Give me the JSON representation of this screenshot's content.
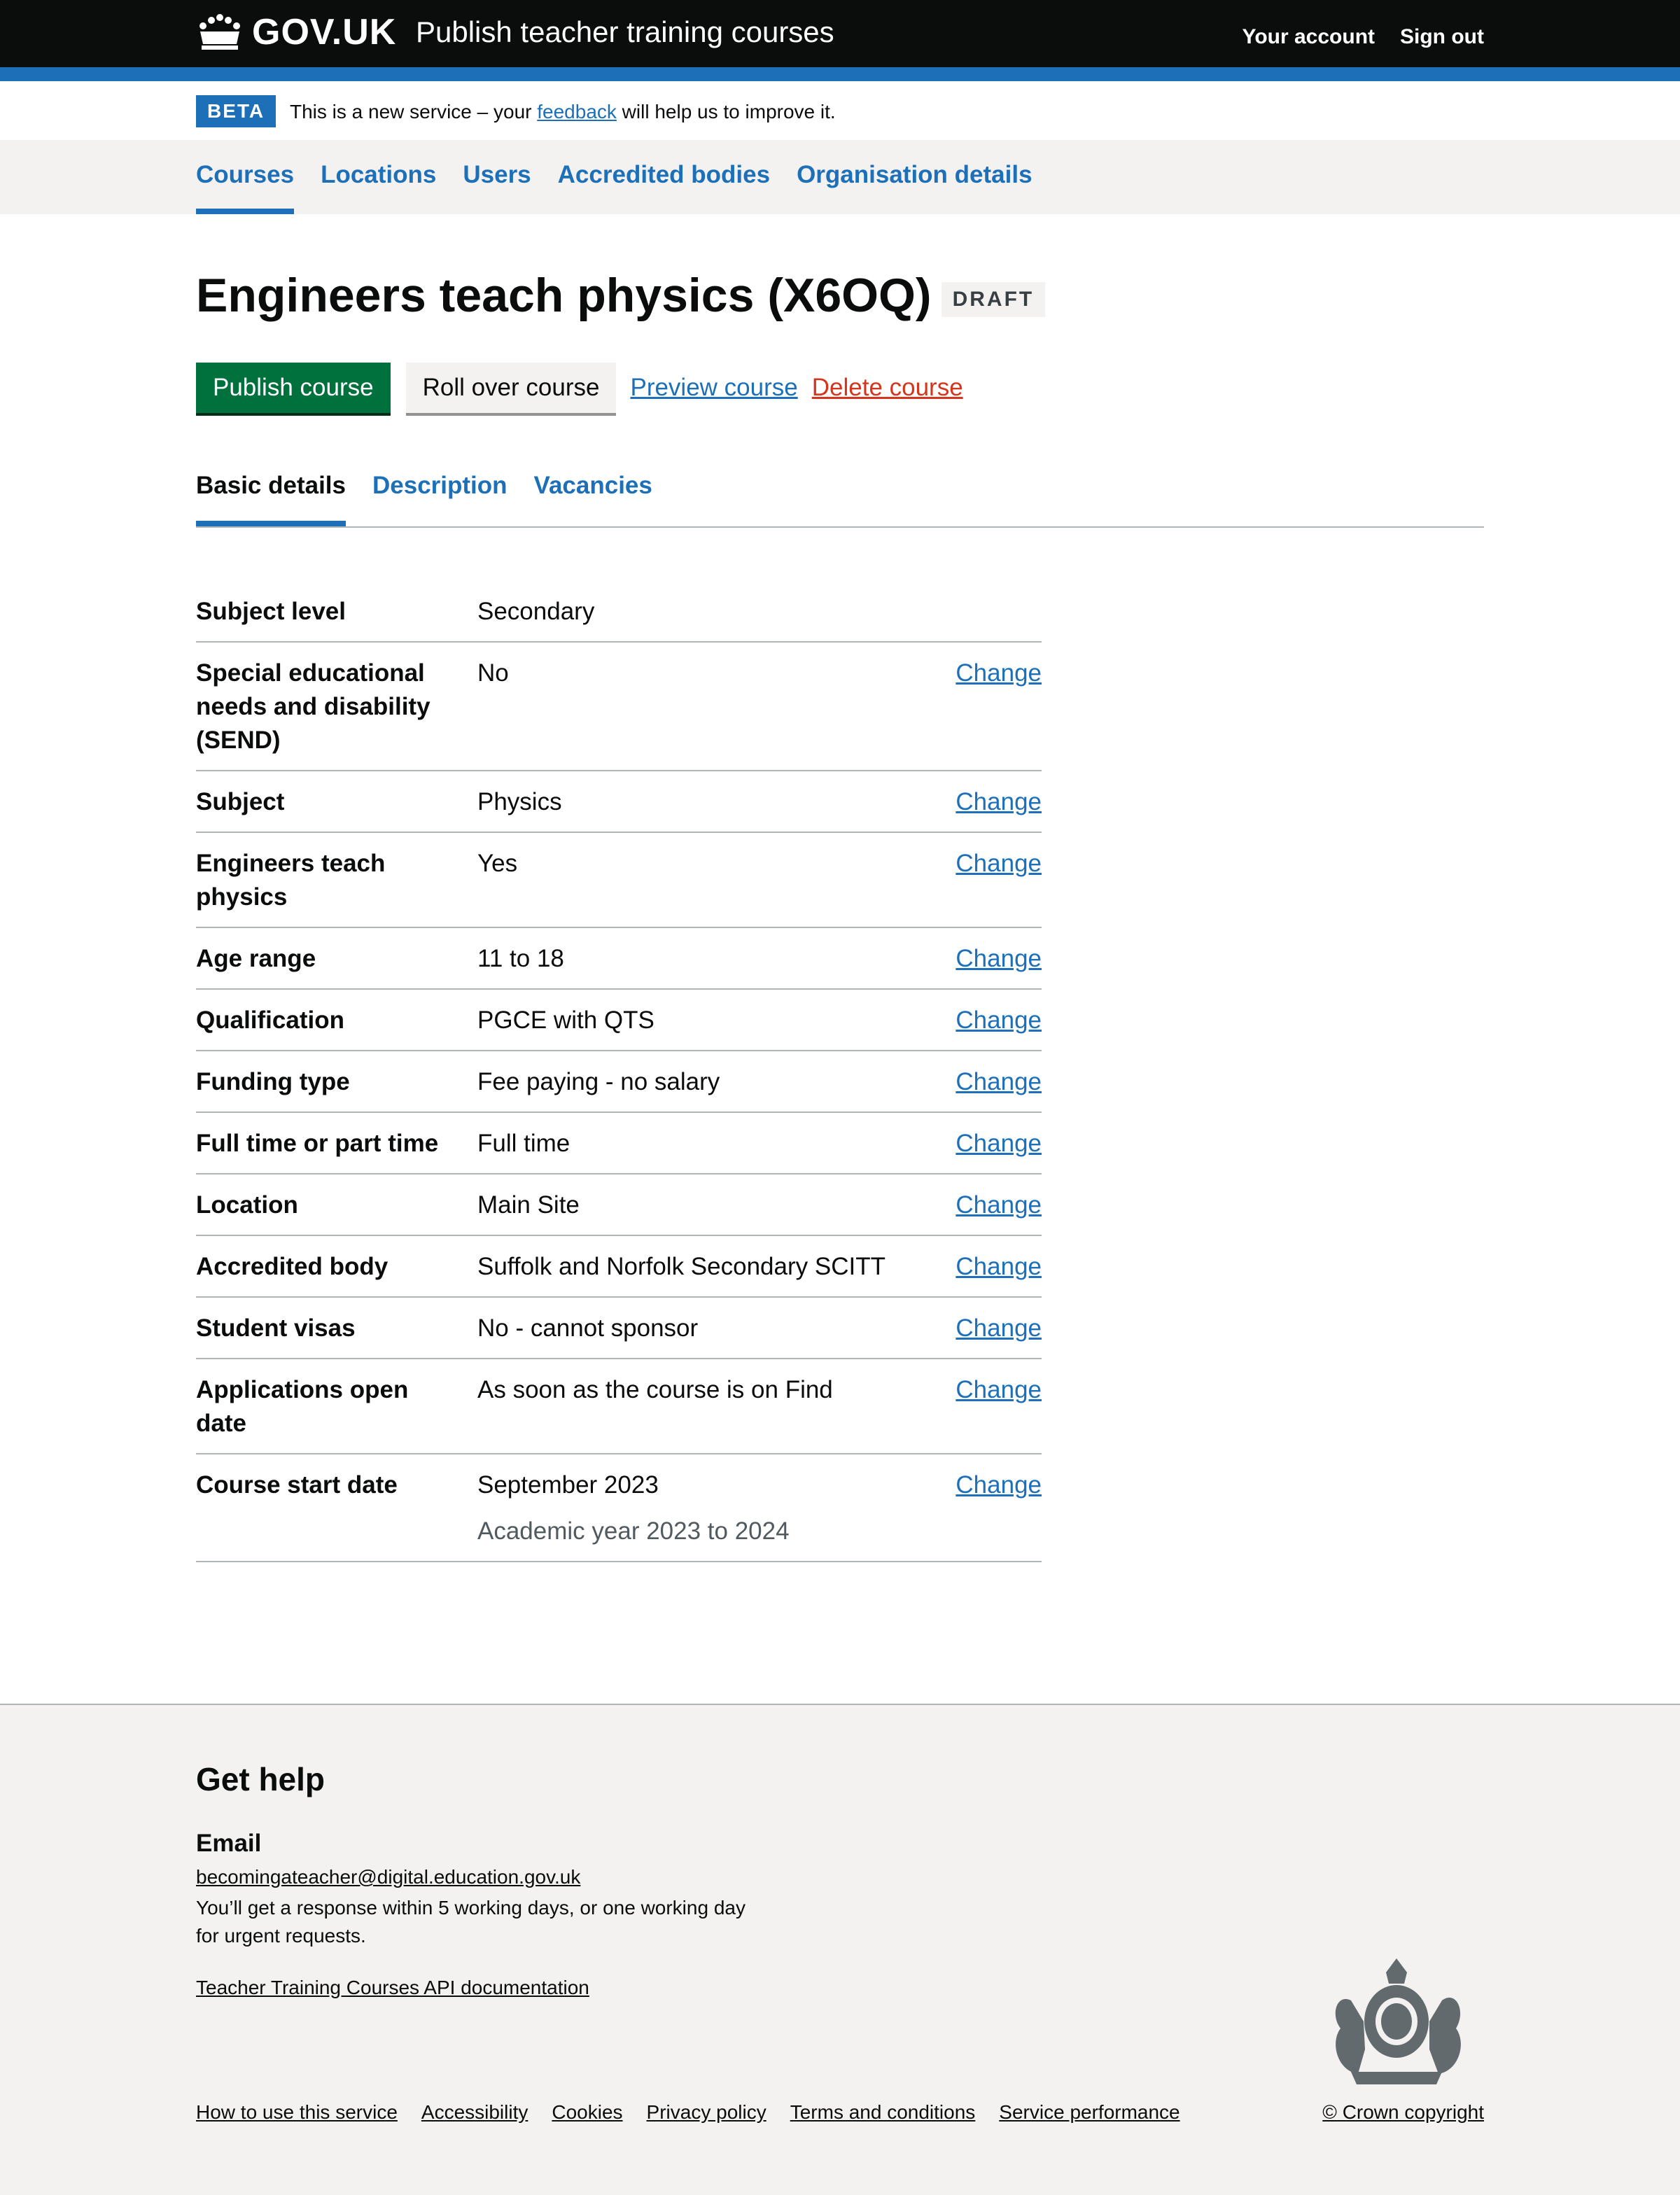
{
  "header": {
    "logo_text": "GOV.UK",
    "service_name": "Publish teacher training courses",
    "nav": [
      "Your account",
      "Sign out"
    ]
  },
  "beta": {
    "tag": "BETA",
    "text_before": "This is a new service – your ",
    "link": "feedback",
    "text_after": " will help us to improve it."
  },
  "subnav": {
    "items": [
      "Courses",
      "Locations",
      "Users",
      "Accredited bodies",
      "Organisation details"
    ],
    "active": "Courses"
  },
  "page": {
    "title": "Engineers teach physics (X6OQ)",
    "status": "DRAFT"
  },
  "actions": {
    "publish": "Publish course",
    "rollover": "Roll over course",
    "preview": "Preview course",
    "delete": "Delete course"
  },
  "tabs": [
    "Basic details",
    "Description",
    "Vacancies"
  ],
  "summary": [
    {
      "key": "Subject level",
      "value": "Secondary",
      "change": ""
    },
    {
      "key": "Special educational needs and disability (SEND)",
      "value": "No",
      "change": "Change"
    },
    {
      "key": "Subject",
      "value": "Physics",
      "change": "Change"
    },
    {
      "key": "Engineers teach physics",
      "value": "Yes",
      "change": "Change"
    },
    {
      "key": "Age range",
      "value": "11 to 18",
      "change": "Change"
    },
    {
      "key": "Qualification",
      "value": "PGCE with QTS",
      "change": "Change"
    },
    {
      "key": "Funding type",
      "value": "Fee paying - no salary",
      "change": "Change"
    },
    {
      "key": "Full time or part time",
      "value": "Full time",
      "change": "Change"
    },
    {
      "key": "Location",
      "value": "Main Site",
      "change": "Change"
    },
    {
      "key": "Accredited body",
      "value": "Suffolk and Norfolk Secondary SCITT",
      "change": "Change"
    },
    {
      "key": "Student visas",
      "value": "No - cannot sponsor",
      "change": "Change"
    },
    {
      "key": "Applications open date",
      "value": "As soon as the course is on Find",
      "change": "Change"
    },
    {
      "key": "Course start date",
      "value": "September 2023",
      "hint": "Academic year 2023 to 2024",
      "change": "Change"
    }
  ],
  "footer": {
    "heading": "Get help",
    "email_heading": "Email",
    "email": "becomingateacher@digital.education.gov.uk",
    "response": "You’ll get a response within 5 working days, or one working day for urgent requests.",
    "api_link": "Teacher Training Courses API documentation",
    "links": [
      "How to use this service",
      "Accessibility",
      "Cookies",
      "Privacy policy",
      "Terms and conditions",
      "Service performance"
    ],
    "copyright": "© Crown copyright"
  },
  "colors": {
    "header": "#0b0c0c",
    "brand_blue": "#1d70b8",
    "primary_button": "#00703c",
    "danger": "#d4351c",
    "panel_grey": "#f3f2f1"
  }
}
